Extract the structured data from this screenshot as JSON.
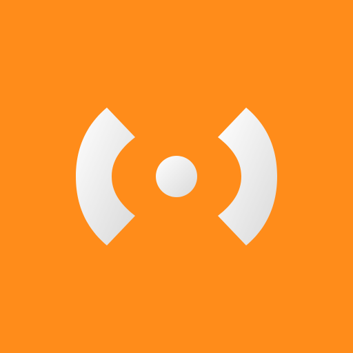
{
  "app_icon": {
    "icon": "broadcast-signal-icon",
    "background_color": "#ff8c1a",
    "foreground_color": "#f4f4f4",
    "shadow_color": "#d9d9d9"
  }
}
